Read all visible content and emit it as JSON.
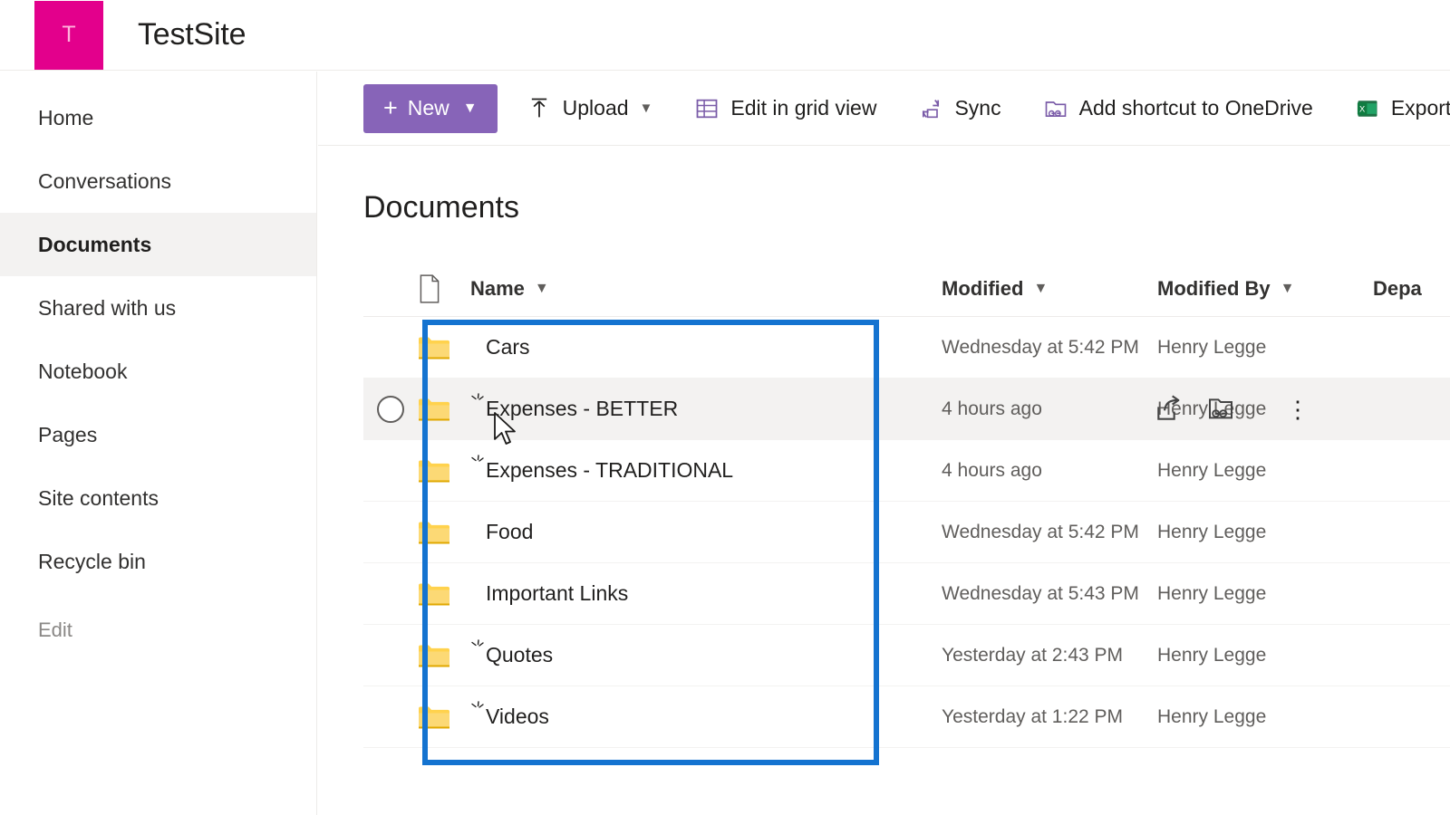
{
  "header": {
    "logo_letter": "T",
    "site_title": "TestSite",
    "logo_color": "#e3008c"
  },
  "left_nav": {
    "items": [
      {
        "label": "Home",
        "selected": false
      },
      {
        "label": "Conversations",
        "selected": false
      },
      {
        "label": "Documents",
        "selected": true
      },
      {
        "label": "Shared with us",
        "selected": false
      },
      {
        "label": "Notebook",
        "selected": false
      },
      {
        "label": "Pages",
        "selected": false
      },
      {
        "label": "Site contents",
        "selected": false
      },
      {
        "label": "Recycle bin",
        "selected": false
      }
    ],
    "edit_label": "Edit"
  },
  "command_bar": {
    "new_label": "New",
    "new_button_color": "#8764b8",
    "upload_label": "Upload",
    "edit_grid_label": "Edit in grid view",
    "sync_label": "Sync",
    "add_shortcut_label": "Add shortcut to OneDrive",
    "export_excel_label": "Export to Exc"
  },
  "main": {
    "page_title": "Documents",
    "columns": {
      "name": "Name",
      "modified": "Modified",
      "modified_by": "Modified By",
      "department": "Depa"
    },
    "rows": [
      {
        "name": "Cars",
        "modified": "Wednesday at 5:42 PM",
        "modified_by": "Henry Legge",
        "department": "",
        "is_new": false,
        "hovered": false
      },
      {
        "name": "Expenses - BETTER",
        "modified": "4 hours ago",
        "modified_by": "Henry Legge",
        "department": "",
        "is_new": true,
        "hovered": true
      },
      {
        "name": "Expenses - TRADITIONAL",
        "modified": "4 hours ago",
        "modified_by": "Henry Legge",
        "department": "",
        "is_new": true,
        "hovered": false
      },
      {
        "name": "Food",
        "modified": "Wednesday at 5:42 PM",
        "modified_by": "Henry Legge",
        "department": "",
        "is_new": false,
        "hovered": false
      },
      {
        "name": "Important Links",
        "modified": "Wednesday at 5:43 PM",
        "modified_by": "Henry Legge",
        "department": "",
        "is_new": false,
        "hovered": false
      },
      {
        "name": "Quotes",
        "modified": "Yesterday at 2:43 PM",
        "modified_by": "Henry Legge",
        "department": "",
        "is_new": true,
        "hovered": false
      },
      {
        "name": "Videos",
        "modified": "Yesterday at 1:22 PM",
        "modified_by": "Henry Legge",
        "department": "",
        "is_new": true,
        "hovered": false
      }
    ],
    "row_action_icons": [
      "share-icon",
      "copy-link-icon",
      "more-options-icon"
    ]
  },
  "annotation": {
    "type": "highlight-rectangle",
    "color": "#1473d0"
  }
}
